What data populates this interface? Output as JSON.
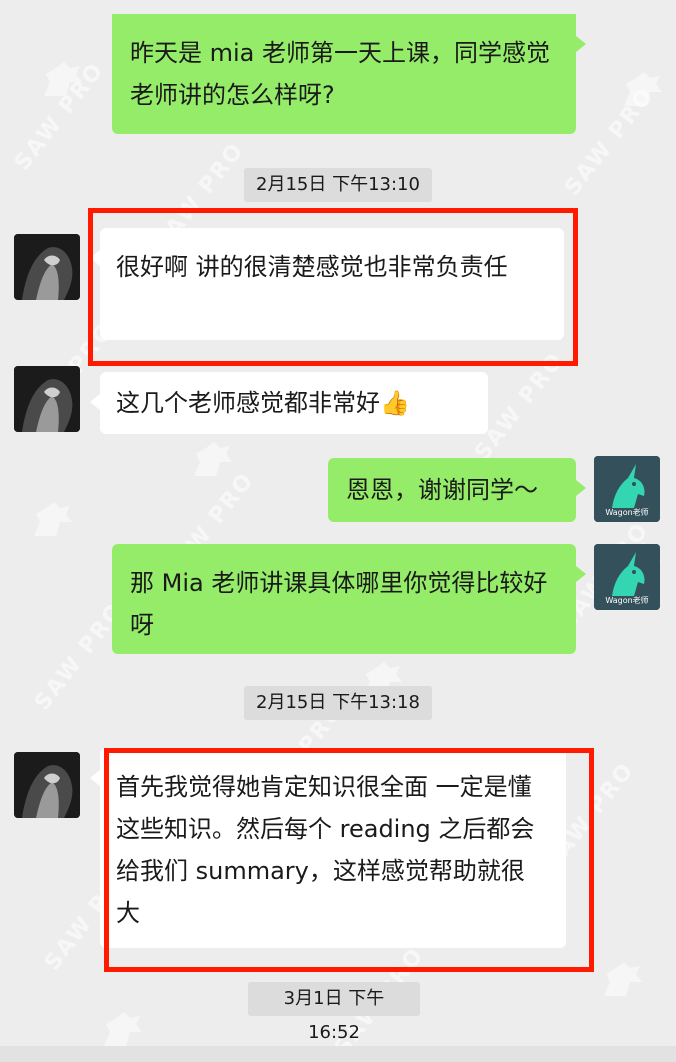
{
  "chat": {
    "messages": [
      {
        "id": "m1",
        "sender": "self",
        "text": "昨天是 mia 老师第一天上课，同学感觉老师讲的怎么样呀?"
      },
      {
        "id": "t1",
        "type": "timestamp",
        "text": "2月15日 下午13:10"
      },
      {
        "id": "m2",
        "sender": "other",
        "text": "很好啊 讲的很清楚感觉也非常负责任"
      },
      {
        "id": "m3",
        "sender": "other",
        "text": "这几个老师感觉都非常好",
        "emoji": "👍"
      },
      {
        "id": "m4",
        "sender": "self",
        "text": "恩恩，谢谢同学～"
      },
      {
        "id": "m5",
        "sender": "self",
        "text": "那 Mia 老师讲课具体哪里你觉得比较好呀"
      },
      {
        "id": "t2",
        "type": "timestamp",
        "text": "2月15日 下午13:18"
      },
      {
        "id": "m6",
        "sender": "other",
        "text": "首先我觉得她肯定知识很全面 一定是懂这些知识。然后每个 reading 之后都会给我们 summary，这样感觉帮助就很大"
      },
      {
        "id": "t3",
        "type": "timestamp",
        "text": "3月1日 下午16:52"
      }
    ]
  },
  "avatars": {
    "self_label": "Wagon老师"
  },
  "watermark": {
    "text": "SAW PRO"
  },
  "colors": {
    "background": "#ededed",
    "self_bubble": "#95ec69",
    "other_bubble": "#ffffff",
    "highlight": "#ff1a00",
    "timestamp_bg": "#dcdcdc"
  }
}
